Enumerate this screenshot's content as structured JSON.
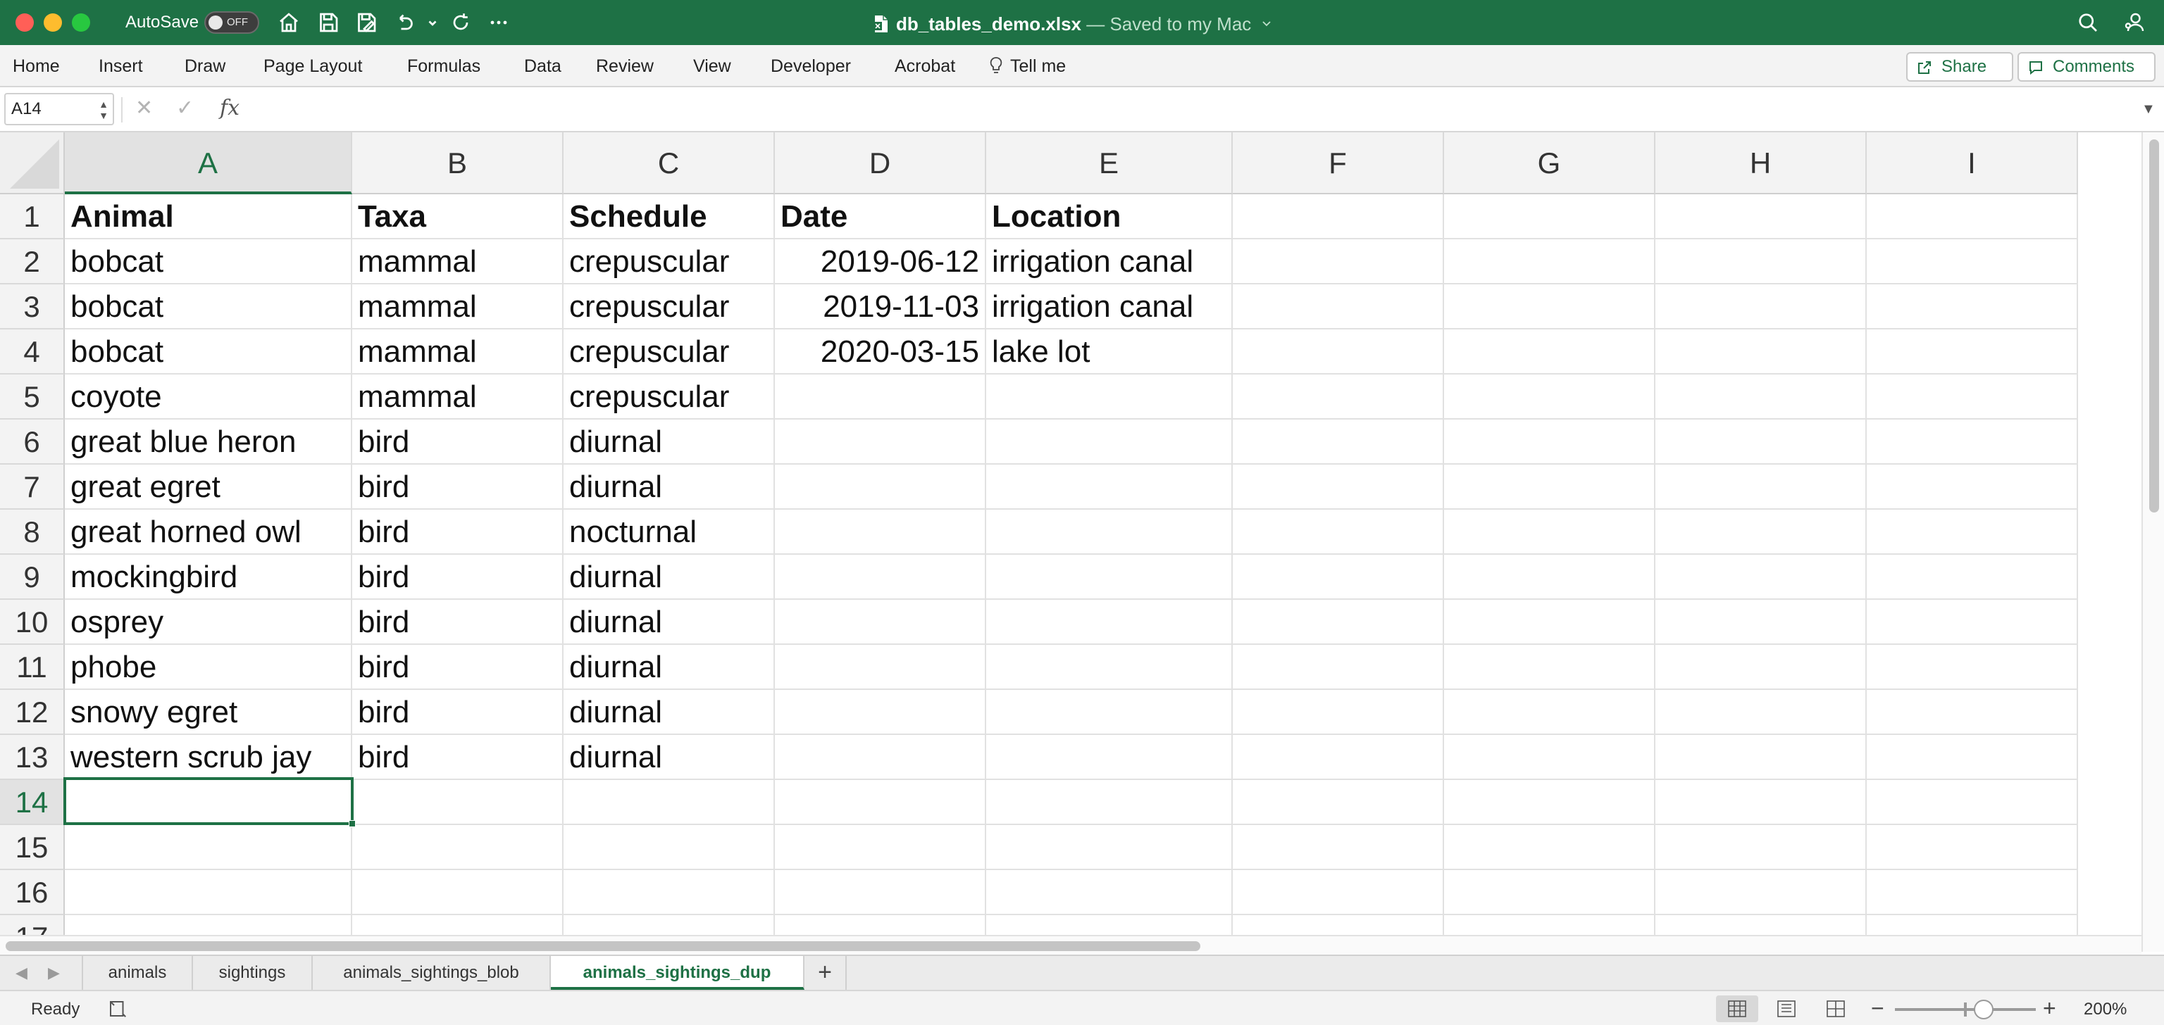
{
  "app": {
    "autosave_label": "AutoSave",
    "autosave_state": "OFF",
    "file_name": "db_tables_demo.xlsx",
    "save_status": " — Saved to my Mac",
    "accent_color": "#1e7145"
  },
  "ribbon": {
    "tabs": [
      "Home",
      "Insert",
      "Draw",
      "Page Layout",
      "Formulas",
      "Data",
      "Review",
      "View",
      "Developer",
      "Acrobat"
    ],
    "tell_me": "Tell me",
    "share": "Share",
    "comments": "Comments"
  },
  "formula_bar": {
    "name_box": "A14",
    "cancel_glyph": "✕",
    "enter_glyph": "✓",
    "fx": "fx",
    "value": ""
  },
  "grid": {
    "columns": [
      "A",
      "B",
      "C",
      "D",
      "E",
      "F",
      "G",
      "H",
      "I"
    ],
    "rows": [
      "1",
      "2",
      "3",
      "4",
      "5",
      "6",
      "7",
      "8",
      "9",
      "10",
      "11",
      "12",
      "13",
      "14",
      "15",
      "16",
      "17"
    ],
    "active_cell": "A14",
    "header": [
      "Animal",
      "Taxa",
      "Schedule",
      "Date",
      "Location"
    ],
    "data": [
      [
        "bobcat",
        "mammal",
        "crepuscular",
        "2019-06-12",
        "irrigation canal"
      ],
      [
        "bobcat",
        "mammal",
        "crepuscular",
        "2019-11-03",
        "irrigation canal"
      ],
      [
        "bobcat",
        "mammal",
        "crepuscular",
        "2020-03-15",
        "lake lot"
      ],
      [
        "coyote",
        "mammal",
        "crepuscular",
        "",
        ""
      ],
      [
        "great blue heron",
        "bird",
        "diurnal",
        "",
        ""
      ],
      [
        "great egret",
        "bird",
        "diurnal",
        "",
        ""
      ],
      [
        "great horned owl",
        "bird",
        "nocturnal",
        "",
        ""
      ],
      [
        "mockingbird",
        "bird",
        "diurnal",
        "",
        ""
      ],
      [
        "osprey",
        "bird",
        "diurnal",
        "",
        ""
      ],
      [
        "phobe",
        "bird",
        "diurnal",
        "",
        ""
      ],
      [
        "snowy egret",
        "bird",
        "diurnal",
        "",
        ""
      ],
      [
        "western scrub jay",
        "bird",
        "diurnal",
        "",
        ""
      ]
    ]
  },
  "sheets": {
    "tabs": [
      "animals",
      "sightings",
      "animals_sightings_blob",
      "animals_sightings_dup"
    ],
    "active": "animals_sightings_dup",
    "add_label": "+"
  },
  "status": {
    "text": "Ready",
    "zoom": "200%"
  }
}
